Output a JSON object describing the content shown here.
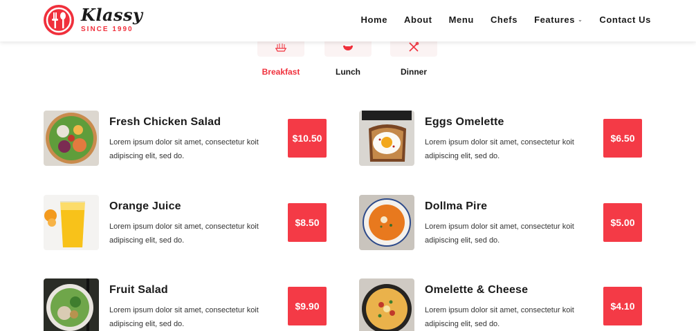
{
  "brand": {
    "name": "Klassy",
    "since": "SINCE 1990",
    "accent": "#f0303c"
  },
  "nav": [
    {
      "label": "Home"
    },
    {
      "label": "About"
    },
    {
      "label": "Menu"
    },
    {
      "label": "Chefs"
    },
    {
      "label": "Features",
      "has_dropdown": true
    },
    {
      "label": "Contact Us"
    }
  ],
  "tabs": [
    {
      "label": "Breakfast",
      "icon": "breakfast-icon",
      "active": true
    },
    {
      "label": "Lunch",
      "icon": "lunch-icon",
      "active": false
    },
    {
      "label": "Dinner",
      "icon": "dinner-icon",
      "active": false
    }
  ],
  "items": [
    {
      "title": "Fresh Chicken Salad",
      "desc": "Lorem ipsum dolor sit amet, consectetur koit adipiscing elit, sed do.",
      "price": "$10.50"
    },
    {
      "title": "Eggs Omelette",
      "desc": "Lorem ipsum dolor sit amet, consectetur koit adipiscing elit, sed do.",
      "price": "$6.50"
    },
    {
      "title": "Orange Juice",
      "desc": "Lorem ipsum dolor sit amet, consectetur koit adipiscing elit, sed do.",
      "price": "$8.50"
    },
    {
      "title": "Dollma Pire",
      "desc": "Lorem ipsum dolor sit amet, consectetur koit adipiscing elit, sed do.",
      "price": "$5.00"
    },
    {
      "title": "Fruit Salad",
      "desc": "Lorem ipsum dolor sit amet, consectetur koit adipiscing elit, sed do.",
      "price": "$9.90"
    },
    {
      "title": "Omelette & Cheese",
      "desc": "Lorem ipsum dolor sit amet, consectetur koit adipiscing elit, sed do.",
      "price": "$4.10"
    }
  ]
}
